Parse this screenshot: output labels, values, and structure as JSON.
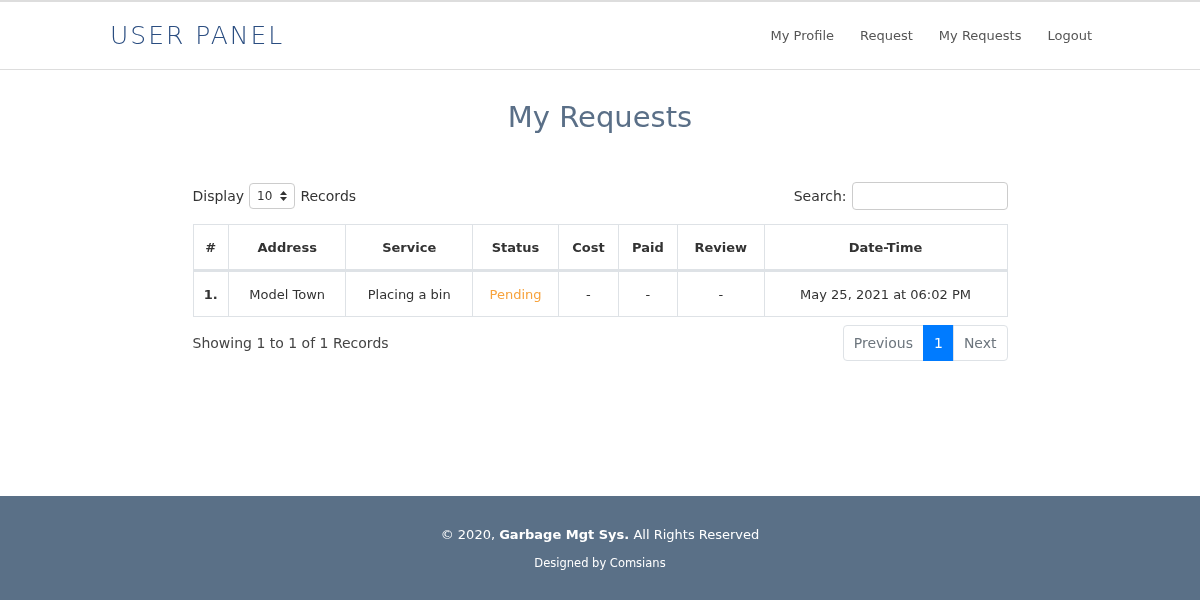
{
  "brand": "USER PANEL",
  "nav": [
    "My Profile",
    "Request",
    "My Requests",
    "Logout"
  ],
  "title": "My Requests",
  "display": {
    "label": "Display",
    "value": "10",
    "suffix": "Records"
  },
  "search": {
    "label": "Search:"
  },
  "table": {
    "columns": [
      "#",
      "Address",
      "Service",
      "Status",
      "Cost",
      "Paid",
      "Review",
      "Date-Time"
    ],
    "rows": [
      {
        "cells": [
          "1.",
          "Model Town",
          "Placing a bin",
          "Pending",
          "-",
          "-",
          "-",
          "May 25, 2021 at 06:02 PM"
        ],
        "color": "#f7a23b"
      }
    ]
  },
  "info": "Showing 1 to 1 of 1 Records",
  "pagination": {
    "previous": "Previous",
    "pages": [
      {
        "label": "1",
        "selected": true
      }
    ],
    "next": "Next"
  },
  "footer": {
    "copyright": "© 2020, **Garbage Mgt Sys.** All Rights Reserved",
    "credit": "Designed by Comsians"
  }
}
